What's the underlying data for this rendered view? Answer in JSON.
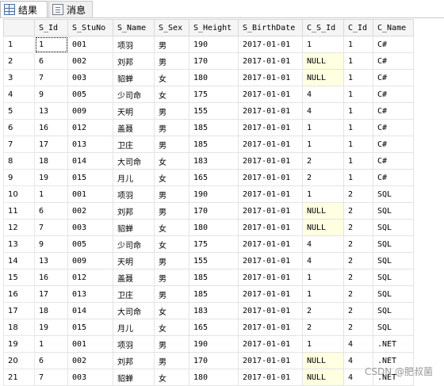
{
  "tabs": [
    {
      "label": "结果",
      "icon": "results-grid-icon"
    },
    {
      "label": "消息",
      "icon": "messages-icon"
    }
  ],
  "columns": [
    "S_Id",
    "S_StuNo",
    "S_Name",
    "S_Sex",
    "S_Height",
    "S_BirthDate",
    "C_S_Id",
    "C_Id",
    "C_Name"
  ],
  "rows": [
    [
      "1",
      "1",
      "001",
      "项羽",
      "男",
      "190",
      "2017-01-01",
      "1",
      "1",
      "C#"
    ],
    [
      "2",
      "6",
      "002",
      "刘邦",
      "男",
      "170",
      "2017-01-01",
      "NULL",
      "1",
      "C#"
    ],
    [
      "3",
      "7",
      "003",
      "貂蝉",
      "女",
      "180",
      "2017-01-01",
      "NULL",
      "1",
      "C#"
    ],
    [
      "4",
      "9",
      "005",
      "少司命",
      "女",
      "175",
      "2017-01-01",
      "4",
      "1",
      "C#"
    ],
    [
      "5",
      "13",
      "009",
      "天明",
      "男",
      "155",
      "2017-01-01",
      "4",
      "1",
      "C#"
    ],
    [
      "6",
      "16",
      "012",
      "盖聂",
      "男",
      "185",
      "2017-01-01",
      "1",
      "1",
      "C#"
    ],
    [
      "7",
      "17",
      "013",
      "卫庄",
      "男",
      "185",
      "2017-01-01",
      "1",
      "1",
      "C#"
    ],
    [
      "8",
      "18",
      "014",
      "大司命",
      "女",
      "183",
      "2017-01-01",
      "2",
      "1",
      "C#"
    ],
    [
      "9",
      "19",
      "015",
      "月儿",
      "女",
      "165",
      "2017-01-01",
      "2",
      "1",
      "C#"
    ],
    [
      "10",
      "1",
      "001",
      "项羽",
      "男",
      "190",
      "2017-01-01",
      "1",
      "2",
      "SQL"
    ],
    [
      "11",
      "6",
      "002",
      "刘邦",
      "男",
      "170",
      "2017-01-01",
      "NULL",
      "2",
      "SQL"
    ],
    [
      "12",
      "7",
      "003",
      "貂蝉",
      "女",
      "180",
      "2017-01-01",
      "NULL",
      "2",
      "SQL"
    ],
    [
      "13",
      "9",
      "005",
      "少司命",
      "女",
      "175",
      "2017-01-01",
      "4",
      "2",
      "SQL"
    ],
    [
      "14",
      "13",
      "009",
      "天明",
      "男",
      "155",
      "2017-01-01",
      "4",
      "2",
      "SQL"
    ],
    [
      "15",
      "16",
      "012",
      "盖聂",
      "男",
      "185",
      "2017-01-01",
      "1",
      "2",
      "SQL"
    ],
    [
      "16",
      "17",
      "013",
      "卫庄",
      "男",
      "185",
      "2017-01-01",
      "1",
      "2",
      "SQL"
    ],
    [
      "17",
      "18",
      "014",
      "大司命",
      "女",
      "183",
      "2017-01-01",
      "2",
      "2",
      "SQL"
    ],
    [
      "18",
      "19",
      "015",
      "月儿",
      "女",
      "165",
      "2017-01-01",
      "2",
      "2",
      "SQL"
    ],
    [
      "19",
      "1",
      "001",
      "项羽",
      "男",
      "190",
      "2017-01-01",
      "1",
      "4",
      ".NET"
    ],
    [
      "20",
      "6",
      "002",
      "刘邦",
      "男",
      "170",
      "2017-01-01",
      "NULL",
      "4",
      ".NET"
    ],
    [
      "21",
      "7",
      "003",
      "貂蝉",
      "女",
      "180",
      "2017-01-01",
      "NULL",
      "4",
      ".NET"
    ]
  ],
  "watermark": "CSDN @肥叔菌",
  "colors": {
    "null_bg": "#ffffe1",
    "header_bg": "#f5f5f5",
    "grid_line": "#e3e3e3"
  }
}
